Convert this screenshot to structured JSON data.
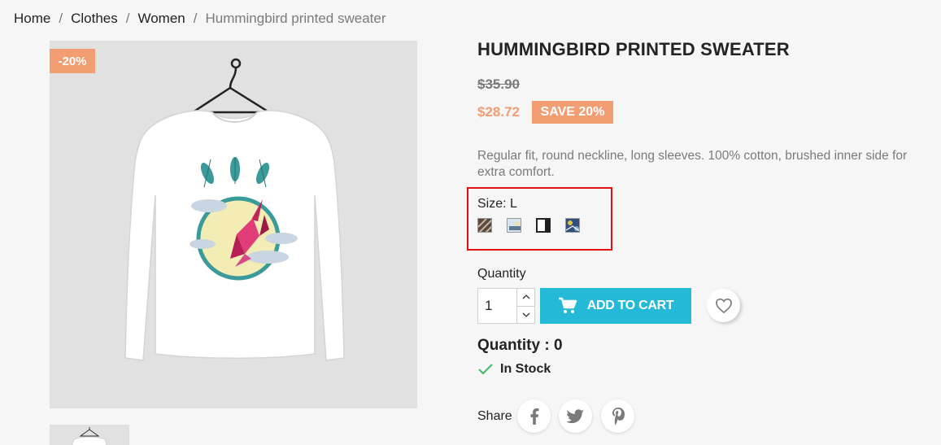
{
  "breadcrumb": {
    "items": [
      "Home",
      "Clothes",
      "Women"
    ],
    "separator": "/",
    "current": "Hummingbird printed sweater"
  },
  "product": {
    "discount_flag": "-20%",
    "title": "HUMMINGBIRD PRINTED SWEATER",
    "regular_price": "$35.90",
    "current_price": "$28.72",
    "save_badge": "SAVE 20%",
    "description": "Regular fit, round neckline, long sleeves. 100% cotton, brushed inner side for extra comfort.",
    "image_alt": "Long-sleeve white sweater with hummingbird print on hanger"
  },
  "variants": {
    "size_label": "Size: L",
    "swatches": [
      "pattern-1",
      "pattern-2",
      "pattern-3",
      "pattern-4"
    ],
    "selected_index": 2
  },
  "purchase": {
    "quantity_label": "Quantity",
    "quantity_value": "1",
    "add_to_cart_label": "ADD TO CART",
    "stock_quantity": "Quantity : 0",
    "availability": "In Stock"
  },
  "share": {
    "label": "Share",
    "networks": [
      "facebook-icon",
      "twitter-icon",
      "pinterest-icon"
    ]
  },
  "colors": {
    "accent": "#24b9d7",
    "discount": "#f39d72",
    "in_stock_check": "#4cbb6c",
    "highlight_box": "#e01010"
  }
}
